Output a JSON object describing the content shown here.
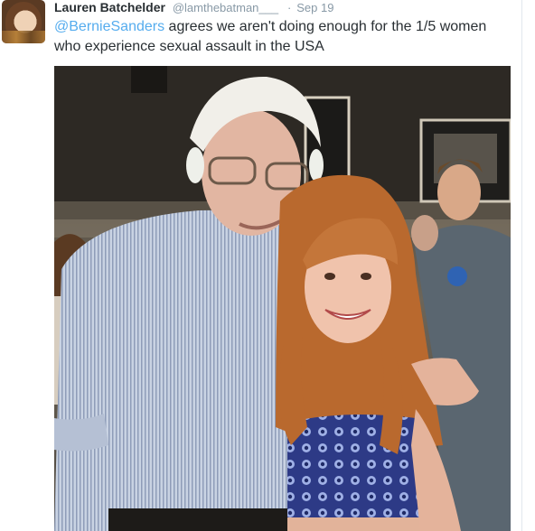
{
  "tweet": {
    "author_name": "Lauren Batchelder",
    "author_handle": "@lamthebatman___",
    "separator": "·",
    "date": "Sep 19",
    "mention": "@BernieSanders",
    "text_rest": " agrees we aren't doing enough for the 1/5 women who experience sexual assault in the USA"
  },
  "icons": {
    "avatar": "profile-photo",
    "photo": "tweet-photo"
  }
}
